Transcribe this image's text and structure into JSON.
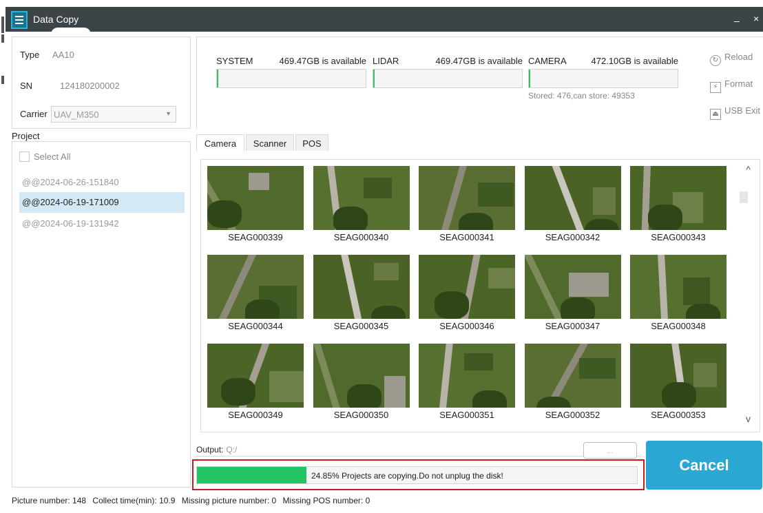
{
  "window": {
    "title": "Data Copy",
    "minimize_label": "_",
    "close_label": "×",
    "app_icon": "data-copy-icon"
  },
  "device": {
    "type_label": "Type",
    "type_value": "AA10",
    "sn_label": "SN",
    "sn_value": "124180200002",
    "carrier_label": "Carrier",
    "carrier_value": "UAV_M350"
  },
  "project": {
    "legend": "Project",
    "select_all": "Select All",
    "items": [
      {
        "label": "@@2024-06-26-151840",
        "selected": false
      },
      {
        "label": "@@2024-06-19-171009",
        "selected": true
      },
      {
        "label": "@@2024-06-19-131942",
        "selected": false
      }
    ]
  },
  "storage": {
    "drives": [
      {
        "name": "SYSTEM",
        "available": "469.47GB is available",
        "used_fraction": 0.0
      },
      {
        "name": "LIDAR",
        "available": "469.47GB is available",
        "used_fraction": 0.0
      },
      {
        "name": "CAMERA",
        "available": "472.10GB is available",
        "used_fraction": 0.0
      }
    ],
    "stored_text": "Stored: 476,can store: 49353",
    "reload_label": "Reload",
    "format_label": "Format",
    "usb_exit_label": "USB Exit"
  },
  "tabs": [
    {
      "label": "Camera",
      "active": true
    },
    {
      "label": "Scanner",
      "active": false
    },
    {
      "label": "POS",
      "active": false
    }
  ],
  "gallery": {
    "thumbnails": [
      "SEAG000339",
      "SEAG000340",
      "SEAG000341",
      "SEAG000342",
      "SEAG000343",
      "SEAG000344",
      "SEAG000345",
      "SEAG000346",
      "SEAG000347",
      "SEAG000348",
      "SEAG000349",
      "SEAG000350",
      "SEAG000351",
      "SEAG000352",
      "SEAG000353"
    ],
    "scroll_up": "^",
    "scroll_down": "v"
  },
  "output": {
    "label": "Output:",
    "path": "Q:/",
    "browse_label": "..."
  },
  "progress": {
    "percent": 24.85,
    "text": "24.85% Projects are copying.Do not unplug the disk!"
  },
  "cancel_label": "Cancel",
  "colors": {
    "accent": "#2aa7d2",
    "progress": "#22c464",
    "highlight_border": "#d0191b",
    "selected_row": "#d3e9f5"
  },
  "status": {
    "picture_number": "Picture number: 148",
    "collect_time": "Collect time(min): 10.9",
    "missing_picture": "Missing picture number: 0",
    "missing_pos": "Missing POS number: 0"
  }
}
